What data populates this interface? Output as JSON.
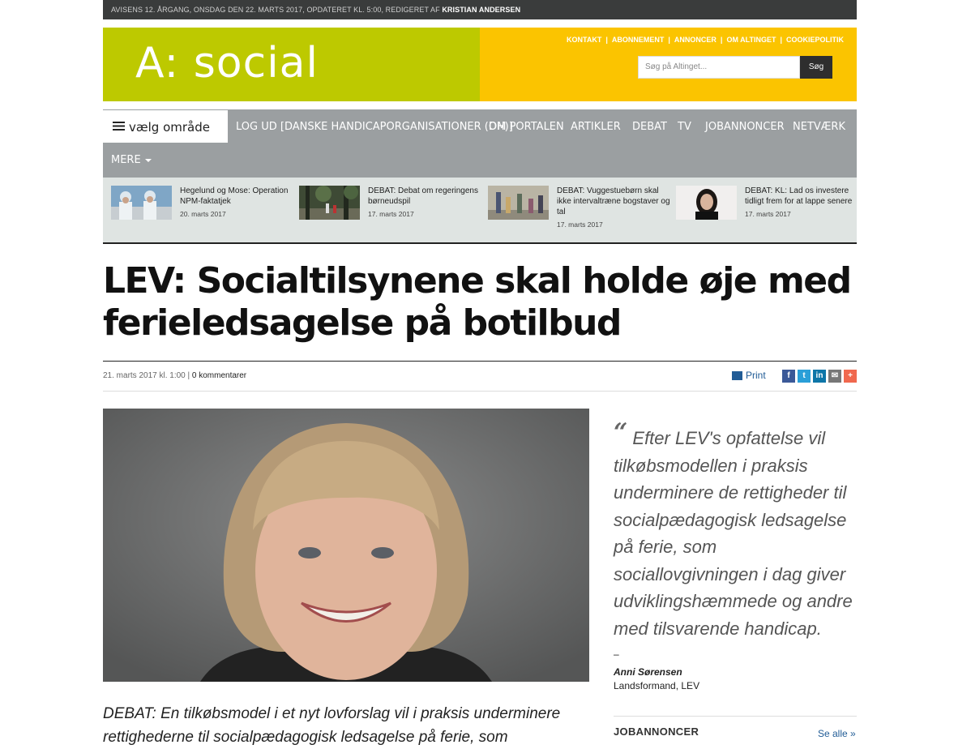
{
  "topbar": {
    "text": "Avisens 12. årgang, onsdag den 22. marts 2017, opdateret kl. 5:00, redigeret af",
    "editor": "Kristian Andersen"
  },
  "header": {
    "logo": "A: social",
    "links": [
      "Kontakt",
      "Abonnement",
      "Annoncer",
      "Om Altinget",
      "Cookiepolitik"
    ],
    "search_placeholder": "Søg på Altinget...",
    "search_button": "Søg"
  },
  "nav": {
    "menu_label": "vælg område",
    "items": [
      "Log ud [Danske Handicaporganisationer (DH)]",
      "Om portalen",
      "Artikler",
      "Debat",
      "TV",
      "Jobannoncer",
      "Netværk"
    ],
    "more": "MERE"
  },
  "related": [
    {
      "title": "Hegelund og Mose: Operation NPM-faktatjek",
      "date": "20. marts 2017"
    },
    {
      "title": "DEBAT: Debat om regeringens børneudspil",
      "date": "17. marts 2017"
    },
    {
      "title": "DEBAT: Vuggestuebørn skal ikke intervaltræne bogstaver og tal",
      "date": "17. marts 2017"
    },
    {
      "title": "DEBAT: KL: Lad os investere tidligt frem for at lappe senere",
      "date": "17. marts 2017"
    }
  ],
  "article": {
    "title": "LEV: Socialtilsynene skal holde øje med ferieledsagelse på botilbud",
    "date": "21. marts 2017 kl. 1:00 |",
    "comments": "0 kommentarer",
    "print": "Print",
    "lead": "DEBAT: En tilkøbsmodel i et nyt lovforslag vil i praksis underminere rettighederne til socialpædagogisk ledsagelse på ferie, som"
  },
  "share_icons": [
    "facebook-icon",
    "twitter-icon",
    "linkedin-icon",
    "email-icon",
    "more-icon"
  ],
  "quote": {
    "mark": "“",
    "text": "Efter LEV's opfattelse vil tilkøbsmodellen i praksis underminere de rettigheder til socialpædagogisk ledsagelse på ferie, som sociallovgivningen i dag giver udviklingshæmmede og andre med tilsvarende handicap.",
    "dash": "–",
    "name": "Anni Sørensen",
    "role": "Landsformand, LEV"
  },
  "sidebar": {
    "jobs_heading": "JOBANNONCER",
    "see_all": "Se alle »"
  },
  "colors": {
    "logo_bg": "#bdc900",
    "header_bg": "#fbc400",
    "nav_bg": "#9b9fa1",
    "strip_bg": "#dfe4e2",
    "link": "#215c96"
  }
}
